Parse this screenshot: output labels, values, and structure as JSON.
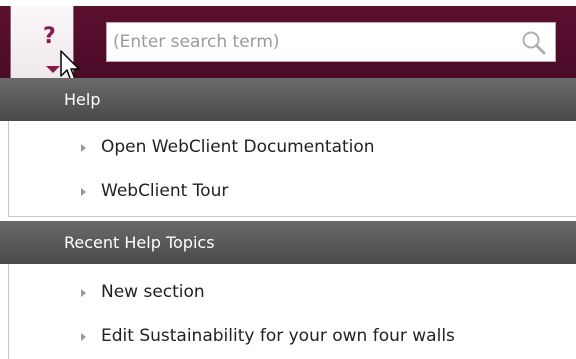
{
  "header": {
    "help_icon": "question-mark",
    "search": {
      "placeholder": "(Enter search term)",
      "icon": "magnifier"
    }
  },
  "sections": [
    {
      "title": "Help",
      "items": [
        {
          "label": "Open WebClient Documentation"
        },
        {
          "label": "WebClient Tour"
        }
      ]
    },
    {
      "title": "Recent Help Topics",
      "items": [
        {
          "label": "New section"
        },
        {
          "label": "Edit Sustainability for your own four walls"
        }
      ]
    }
  ],
  "colors": {
    "topbar": "#4a0a26",
    "accent": "#8b1a4a",
    "section_header": "#555555"
  }
}
